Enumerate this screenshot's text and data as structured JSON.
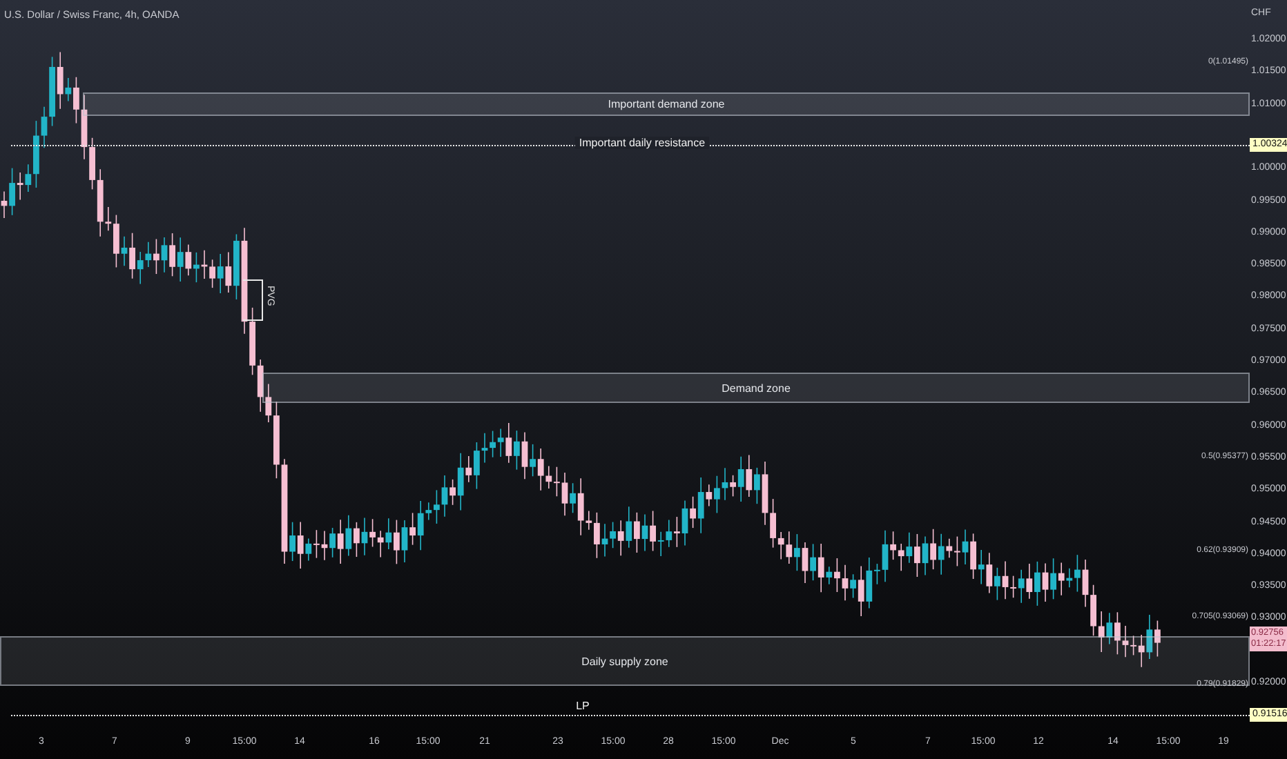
{
  "header": {
    "title": "U.S. Dollar / Swiss Franc, 4h, OANDA"
  },
  "price_axis": {
    "currency": "CHF",
    "ticks": [
      "1.02000",
      "1.01500",
      "1.01000",
      "1.00000",
      "0.99500",
      "0.99000",
      "0.98500",
      "0.98000",
      "0.97500",
      "0.97000",
      "0.96500",
      "0.96000",
      "0.95500",
      "0.95000",
      "0.94500",
      "0.94000",
      "0.93500",
      "0.93000",
      "0.92000"
    ]
  },
  "time_axis": {
    "ticks": [
      "3",
      "7",
      "9",
      "15:00",
      "14",
      "16",
      "15:00",
      "21",
      "23",
      "15:00",
      "28",
      "15:00",
      "Dec",
      "5",
      "7",
      "15:00",
      "12",
      "14",
      "15:00",
      "19"
    ]
  },
  "zones": [
    {
      "label": "Important demand zone"
    },
    {
      "label": "Demand zone"
    },
    {
      "label": "Daily supply zone"
    }
  ],
  "levels": [
    {
      "label": "Important daily resistance",
      "price_tag": "1.00324"
    },
    {
      "label": "LP",
      "price_tag": "0.91516"
    }
  ],
  "fib_labels": [
    "0(1.01495)",
    "0.5(0.95377)",
    "0.62(0.93909)",
    "0.705(0.93069)",
    "0.79(0.91829)"
  ],
  "gap_marker": {
    "label": "PVG"
  },
  "last_price": {
    "price": "0.92756",
    "countdown": "01:22:17"
  }
}
